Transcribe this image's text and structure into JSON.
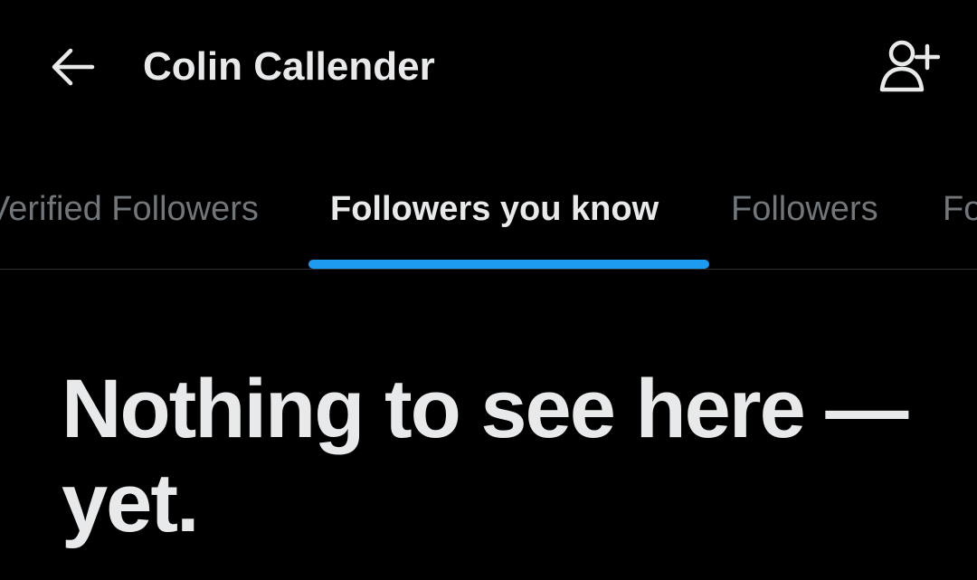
{
  "header": {
    "title": "Colin Callender",
    "back_icon": "arrow-left-icon",
    "add_user_icon": "person-add-icon"
  },
  "tabs": [
    {
      "label": "Verified Followers",
      "active": false
    },
    {
      "label": "Followers you know",
      "active": true
    },
    {
      "label": "Followers",
      "active": false
    },
    {
      "label": "Following",
      "active": false
    }
  ],
  "empty_state": {
    "title": "Nothing to see here — yet."
  },
  "colors": {
    "background": "#000000",
    "text_primary": "#e7e9ea",
    "text_secondary": "#71767b",
    "accent": "#1d9bf0",
    "divider": "#2f3336"
  }
}
